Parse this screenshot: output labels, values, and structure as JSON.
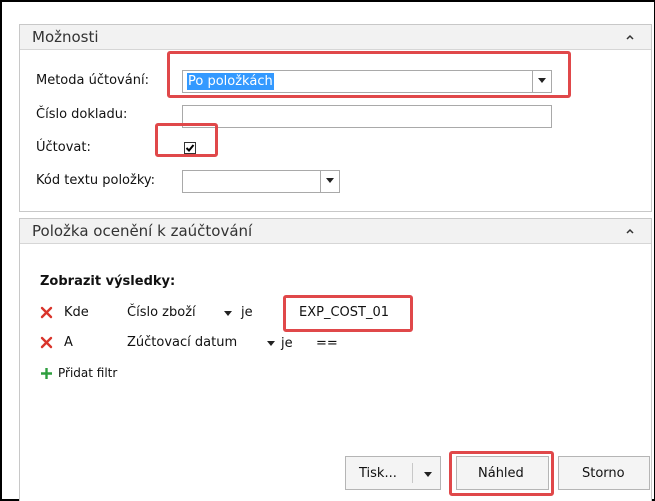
{
  "options_panel": {
    "title": "Možnosti",
    "fields": {
      "posting_method": {
        "label": "Metoda účtování:",
        "value": "Po položkách"
      },
      "document_no": {
        "label": "Číslo dokladu:",
        "value": ""
      },
      "post": {
        "label": "Účtovat:",
        "checked": true
      },
      "item_text_code": {
        "label": "Kód textu položky:",
        "value": ""
      }
    }
  },
  "filter_panel": {
    "title": "Položka ocenění k zaúčtování",
    "show_results_label": "Zobrazit výsledky:",
    "filters": [
      {
        "conjunction": "Kde",
        "field": "Číslo zboží",
        "operator": "je",
        "value": "EXP_COST_01"
      },
      {
        "conjunction": "A",
        "field": "Zúčtovací datum",
        "operator": "je",
        "value": "=="
      }
    ],
    "add_filter_label": "Přidat filtr"
  },
  "buttons": {
    "print_label": "Tisk...",
    "preview_label": "Náhled",
    "cancel_label": "Storno"
  },
  "colors": {
    "highlight": "#e0484a",
    "selection": "#3399ff",
    "remove_icon": "#d9342b",
    "add_icon": "#2e9e3e"
  }
}
